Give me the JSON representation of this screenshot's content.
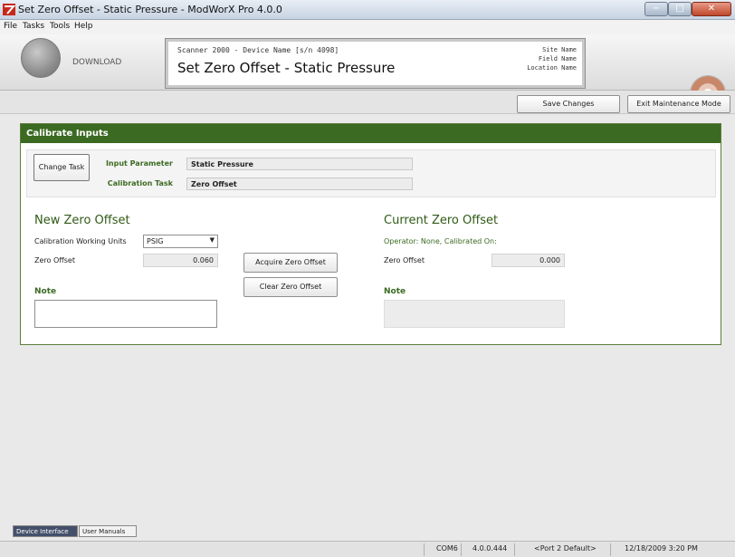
{
  "window": {
    "title": "Set Zero Offset - Static Pressure - ModWorX Pro 4.0.0",
    "controls": [
      "−",
      "□",
      "✕"
    ]
  },
  "menu": [
    "File",
    "Tasks",
    "Tools",
    "Help"
  ],
  "header": {
    "download_label": "DOWNLOAD",
    "device_line": "Scanner 2000 - Device Name [s/n 4098]",
    "page_title": "Set Zero Offset - Static Pressure",
    "site_name": "Site Name",
    "field_name": "Field Name",
    "location_name": "Location Name"
  },
  "toolbar": {
    "save_label": "Save Changes",
    "exit_label": "Exit Maintenance Mode"
  },
  "panel": {
    "title": "Calibrate Inputs",
    "change_task_label": "Change Task",
    "input_parameter_label": "Input Parameter",
    "input_parameter_value": "Static Pressure",
    "calibration_task_label": "Calibration Task",
    "calibration_task_value": "Zero Offset"
  },
  "new_offset": {
    "title": "New Zero Offset",
    "units_label": "Calibration Working Units",
    "units_value": "PSIG",
    "zero_offset_label": "Zero Offset",
    "zero_offset_value": "0.060",
    "note_label": "Note"
  },
  "actions": {
    "acquire_label": "Acquire Zero Offset",
    "clear_label": "Clear Zero Offset"
  },
  "current_offset": {
    "title": "Current Zero Offset",
    "operator_line": "Operator: None, Calibrated On:",
    "zero_offset_label": "Zero Offset",
    "zero_offset_value": "0.000",
    "note_label": "Note"
  },
  "bottom_tabs": [
    "Device Interface",
    "User Manuals"
  ],
  "status": {
    "port": "COM6",
    "version": "4.0.0.444",
    "port_default": "<Port 2 Default>",
    "datetime": "12/18/2009 3:20 PM"
  },
  "colors": {
    "accent_green": "#3b6a22",
    "label_green": "#3b6a22"
  }
}
